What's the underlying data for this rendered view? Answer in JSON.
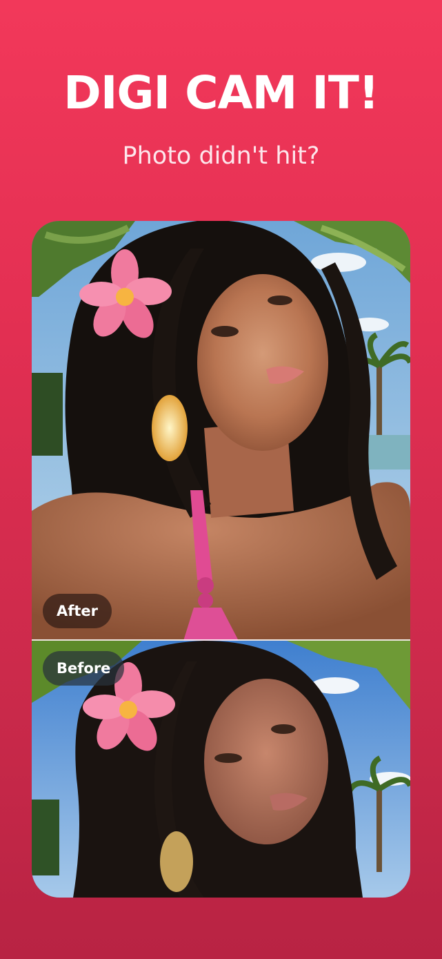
{
  "headline": "DIGI CAM IT!",
  "subheadline": "Photo didn't hit?",
  "comparison": {
    "after_label": "After",
    "before_label": "Before"
  },
  "colors": {
    "background_top": "#f2385a",
    "background_bottom": "#b82343",
    "text_primary": "#ffffff"
  }
}
